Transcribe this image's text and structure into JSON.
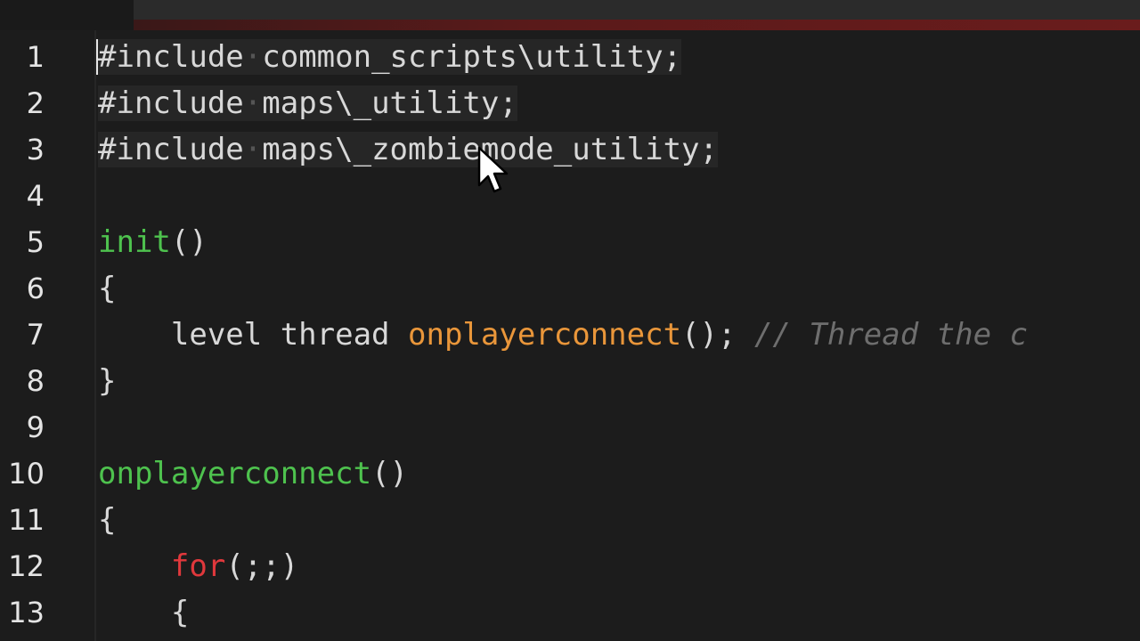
{
  "lines": [
    {
      "n": "1",
      "t": [
        {
          "c": "plain",
          "v": "#include"
        },
        {
          "c": "ws",
          "v": "·"
        },
        {
          "c": "plain",
          "v": "common_scripts\\utility;"
        }
      ]
    },
    {
      "n": "2",
      "t": [
        {
          "c": "plain",
          "v": "#include"
        },
        {
          "c": "ws",
          "v": "·"
        },
        {
          "c": "plain",
          "v": "maps\\_utility;"
        }
      ]
    },
    {
      "n": "3",
      "t": [
        {
          "c": "plain",
          "v": "#include"
        },
        {
          "c": "ws",
          "v": "·"
        },
        {
          "c": "plain",
          "v": "maps\\_zombiemode_utility;"
        }
      ]
    },
    {
      "n": "4",
      "t": []
    },
    {
      "n": "5",
      "t": [
        {
          "c": "fn",
          "v": "init"
        },
        {
          "c": "plain",
          "v": "()"
        }
      ]
    },
    {
      "n": "6",
      "t": [
        {
          "c": "plain",
          "v": "{"
        }
      ]
    },
    {
      "n": "7",
      "t": [
        {
          "c": "plain",
          "v": "    level thread "
        },
        {
          "c": "call",
          "v": "onplayerconnect"
        },
        {
          "c": "plain",
          "v": "(); "
        },
        {
          "c": "cmt",
          "v": "// Thread the c"
        }
      ]
    },
    {
      "n": "8",
      "t": [
        {
          "c": "plain",
          "v": "}"
        }
      ]
    },
    {
      "n": "9",
      "t": []
    },
    {
      "n": "10",
      "t": [
        {
          "c": "fn",
          "v": "onplayerconnect"
        },
        {
          "c": "plain",
          "v": "()"
        }
      ]
    },
    {
      "n": "11",
      "t": [
        {
          "c": "plain",
          "v": "{"
        }
      ]
    },
    {
      "n": "12",
      "t": [
        {
          "c": "plain",
          "v": "    "
        },
        {
          "c": "kw",
          "v": "for"
        },
        {
          "c": "plain",
          "v": "(;;)"
        }
      ]
    },
    {
      "n": "13",
      "t": [
        {
          "c": "plain",
          "v": "    {"
        }
      ]
    }
  ],
  "icons": {
    "cursor": "mouse-pointer-icon"
  },
  "colors": {
    "background": "#1c1c1c",
    "function": "#4ec24e",
    "keyword": "#e0383c",
    "call": "#e9963a",
    "comment": "#6e6e6e",
    "text": "#d8d8d8"
  }
}
